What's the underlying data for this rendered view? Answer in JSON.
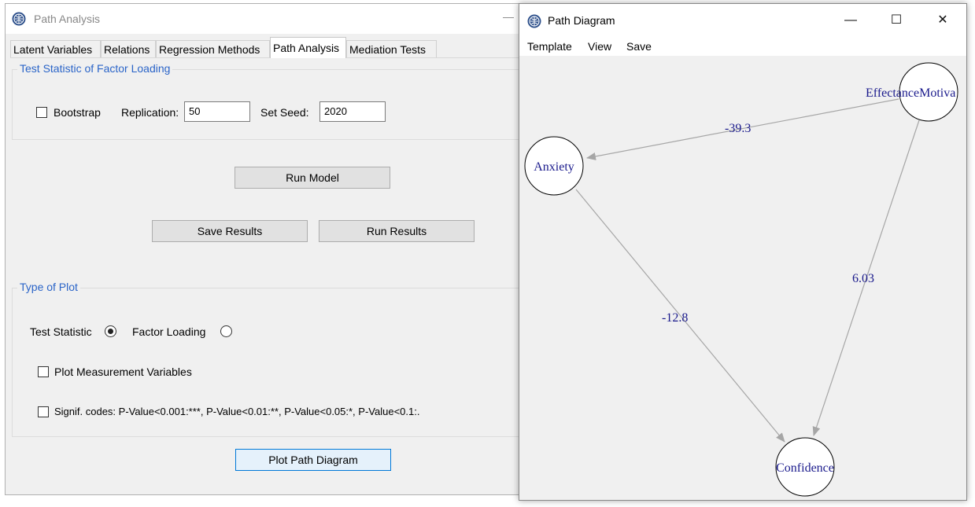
{
  "main_window": {
    "title": "Path Analysis",
    "tabs": [
      "Latent Variables",
      "Relations",
      "Regression Methods",
      "Path Analysis",
      "Mediation Tests"
    ],
    "test_stat_group": {
      "title": "Test Statistic of Factor Loading",
      "bootstrap_label": "Bootstrap",
      "replication_label": "Replication:",
      "replication_value": "50",
      "seed_label": "Set Seed:",
      "seed_value": "2020"
    },
    "buttons": {
      "run_model": "Run Model",
      "save_results": "Save Results",
      "run_results": "Run Results",
      "plot_path": "Plot Path Diagram"
    },
    "plot_group": {
      "title": "Type of Plot",
      "radio_test_statistic": "Test Statistic",
      "radio_factor_loading": "Factor Loading",
      "selected": "Test Statistic",
      "plot_measurement_label": "Plot Measurement Variables",
      "signif_label": "Signif. codes:  P-Value<0.001:***, P-Value<0.01:**, P-Value<0.05:*, P-Value<0.1:."
    }
  },
  "diagram_window": {
    "title": "Path Diagram",
    "menu": [
      "Template",
      "View",
      "Save"
    ],
    "controls": {
      "minimize": "—",
      "maximize": "☐",
      "close": "✕"
    },
    "nodes": {
      "effectance": "EffectanceMotiva",
      "anxiety": "Anxiety",
      "confidence": "Confidence"
    },
    "edges": {
      "effectance_to_anxiety": "-39.3",
      "effectance_to_confidence": "6.03",
      "anxiety_to_confidence": "-12.8"
    },
    "colors": {
      "node_text": "#1a1a8c",
      "edge": "#a6a6a6",
      "label": "#1a1a8c"
    }
  },
  "icons": {
    "app_icon": "rstudio-globe-icon"
  }
}
